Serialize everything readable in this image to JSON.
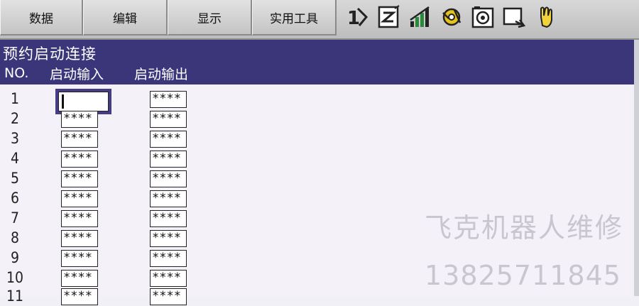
{
  "menu": {
    "items": [
      {
        "label": "数据"
      },
      {
        "label": "编辑"
      },
      {
        "label": "显示"
      },
      {
        "label": "实用工具"
      }
    ]
  },
  "toolbar": {
    "icons": [
      "line-step-icon",
      "edit-page-icon",
      "signal-bars-icon",
      "gear-tool-icon",
      "camera-frame-icon",
      "screen-arrow-icon",
      "hand-pointer-icon"
    ]
  },
  "header": {
    "title": "预约启动连接",
    "col_no": "NO.",
    "col_input": "启动输入",
    "col_output": "启动输出"
  },
  "rows": [
    {
      "no": "1",
      "input": "",
      "output": "****"
    },
    {
      "no": "2",
      "input": "****",
      "output": "****"
    },
    {
      "no": "3",
      "input": "****",
      "output": "****"
    },
    {
      "no": "4",
      "input": "****",
      "output": "****"
    },
    {
      "no": "5",
      "input": "****",
      "output": "****"
    },
    {
      "no": "6",
      "input": "****",
      "output": "****"
    },
    {
      "no": "7",
      "input": "****",
      "output": "****"
    },
    {
      "no": "8",
      "input": "****",
      "output": "****"
    },
    {
      "no": "9",
      "input": "****",
      "output": "****"
    },
    {
      "no": "10",
      "input": "****",
      "output": "****"
    },
    {
      "no": "11",
      "input": "****",
      "output": "****"
    }
  ],
  "watermark": {
    "line1": "飞克机器人维修",
    "line2": "13825711845"
  },
  "colors": {
    "header_bg": "#3b3579",
    "list_bg": "#f4f2f8"
  }
}
